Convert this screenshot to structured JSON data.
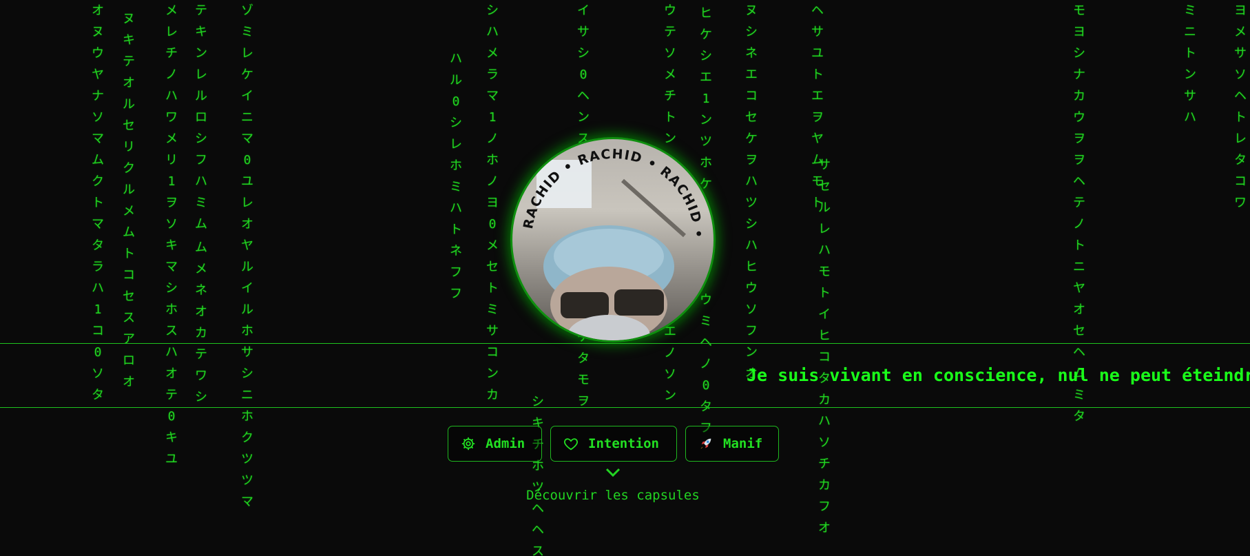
{
  "rain_columns": [
    "オヌウヤナソマムクトマタラハ1コ0ソタ",
    "ヌキテオルセリクルメムトコセスアロオ",
    "メレチノハワメリ1ヲソキマシホスハオテ0キユ",
    "テキンレルロシフハミム",
    "ムメネオカテワシ",
    "ゾミレケイニマ0ユレオヤルイルホサシニホクツツマ",
    "ハル0シレホミハトネフフ",
    "シハメラマ1ノホノヨ0メセトミサコンカ",
    "シキチホツヘヘス",
    "イサシ0ヘンス",
    "ケタモヲ",
    "ウテソメチトン",
    "エノソン",
    "ヒケシエ1ンツホケ",
    "ウミヘノ0タフ",
    "ヌシネエコセケヲハツシハヒウソフンオ",
    "ヘサユトエヲヤムモト",
    "サセルレハモトイヒコタカハソチカフオ",
    "モヨシナカウヲヲヘテノトニヤオセヘムミタ",
    "ミニトンサハ",
    "ヨメサソヘトレタコワ"
  ],
  "avatar": {
    "ring_text": "RACHID • RACHID • RACHID •"
  },
  "banner": {
    "text": "Je suis vivant en conscience, nul ne peut éteindre"
  },
  "buttons": [
    {
      "label": "Admin",
      "icon": "gear-icon"
    },
    {
      "label": "Intention",
      "icon": "heart-icon"
    },
    {
      "label": "Manif",
      "icon": "rocket-icon"
    }
  ],
  "discover": {
    "label": "Découvrir les capsules",
    "icon": "chevron-down-icon"
  },
  "colors": {
    "background": "#0a0a0a",
    "matrix_green": "#22d422",
    "banner_green": "#1aff1a"
  }
}
